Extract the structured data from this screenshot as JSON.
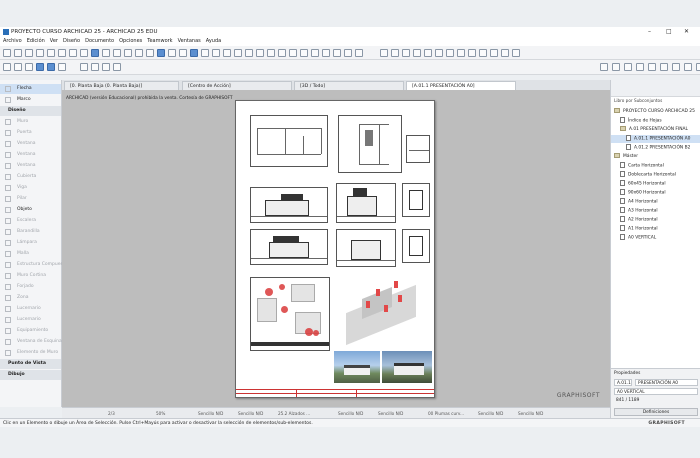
{
  "window": {
    "title": "PROYECTO CURSO ARCHICAD 25 - ARCHICAD 25 EDU",
    "minimize": "–",
    "maximize": "□",
    "close": "✕"
  },
  "menu": [
    "Archivo",
    "Edición",
    "Ver",
    "Diseño",
    "Documento",
    "Opciones",
    "Teamwork",
    "Ventanas",
    "Ayuda"
  ],
  "tabs": [
    {
      "label": "[0. Planta Baja (0. Planta Baja)]",
      "active": false
    },
    {
      "label": "[Centro de Acción]",
      "active": false
    },
    {
      "label": "[3D / Todo]",
      "active": false
    },
    {
      "label": "[A.01.1 PRESENTACIÓN A0]",
      "active": true
    }
  ],
  "toolbox": {
    "items": [
      {
        "label": "Flecha",
        "state": "sel",
        "icon": "arrow-icon"
      },
      {
        "label": "Marco",
        "state": "on",
        "icon": "marquee-icon"
      }
    ],
    "section_design": "Diseño",
    "design_items": [
      {
        "label": "Muro",
        "icon": "wall-icon",
        "state": "off"
      },
      {
        "label": "Puerta",
        "icon": "door-icon",
        "state": "off"
      },
      {
        "label": "Ventana",
        "icon": "window-icon",
        "state": "off"
      },
      {
        "label": "Ventana",
        "icon": "window-icon",
        "state": "off"
      },
      {
        "label": "Ventana",
        "icon": "window-icon",
        "state": "off"
      },
      {
        "label": "Cubierta",
        "icon": "roof-icon",
        "state": "off"
      },
      {
        "label": "Viga",
        "icon": "beam-icon",
        "state": "off"
      },
      {
        "label": "Pilar",
        "icon": "column-icon",
        "state": "off"
      },
      {
        "label": "Objeto",
        "icon": "object-icon",
        "state": "on"
      },
      {
        "label": "Escalera",
        "icon": "stair-icon",
        "state": "off"
      },
      {
        "label": "Barandilla",
        "icon": "railing-icon",
        "state": "off"
      },
      {
        "label": "Lámpara",
        "icon": "lamp-icon",
        "state": "off"
      },
      {
        "label": "Malla",
        "icon": "mesh-icon",
        "state": "off"
      },
      {
        "label": "Estructura Compuesta",
        "icon": "composite-icon",
        "state": "off"
      },
      {
        "label": "Muro Cortina",
        "icon": "curtainwall-icon",
        "state": "off"
      },
      {
        "label": "Forjado",
        "icon": "slab-icon",
        "state": "off"
      },
      {
        "label": "Zona",
        "icon": "zone-icon",
        "state": "off"
      },
      {
        "label": "Lucernario",
        "icon": "skylight-icon",
        "state": "off"
      },
      {
        "label": "Lucernario",
        "icon": "skylight-icon",
        "state": "off"
      },
      {
        "label": "Equipamiento",
        "icon": "equipment-icon",
        "state": "off"
      },
      {
        "label": "Ventana de Esquina",
        "icon": "corner-window-icon",
        "state": "off"
      },
      {
        "label": "Elemento de Muro",
        "icon": "wall-end-icon",
        "state": "off"
      }
    ],
    "section_view": "Punto de Vista",
    "section_draw": "Dibujo"
  },
  "canvas": {
    "info_text": "ARCHICAD (versión Educacional) prohibida la venta. Cortesía de GRAPHISOFT",
    "watermark": "GRAPHISOFT"
  },
  "navbar": {
    "page": "2/3",
    "zoom": "50%",
    "fields": [
      "Sencillo N/D",
      "Sencillo N/D",
      "25.2 Alzados ...",
      "Sencillo N/D",
      "Sencillo N/D",
      "00 Plumas curv...",
      "Sencillo N/D",
      "Sencillo N/D"
    ]
  },
  "navigator": {
    "header": "Libro por Subconjuntos",
    "tree": [
      {
        "label": "PROYECTO CURSO ARCHICAD 25",
        "level": 0,
        "type": "folder",
        "sel": false
      },
      {
        "label": "Índice de Hojas",
        "level": 1,
        "type": "page",
        "sel": false
      },
      {
        "label": "A.01 PRESENTACIÓN FINAL",
        "level": 1,
        "type": "folder",
        "sel": false
      },
      {
        "label": "A.01.1 PRESENTACIÓN A0",
        "level": 2,
        "type": "page",
        "sel": true
      },
      {
        "label": "A.01.2 PRESENTACIÓN B2",
        "level": 2,
        "type": "page",
        "sel": false
      },
      {
        "label": "Máster",
        "level": 0,
        "type": "folder",
        "sel": false
      },
      {
        "label": "Carta Horizontal",
        "level": 1,
        "type": "page",
        "sel": false
      },
      {
        "label": "Doblecarta Horizontal",
        "level": 1,
        "type": "page",
        "sel": false
      },
      {
        "label": "60x45 Horizontal",
        "level": 1,
        "type": "page",
        "sel": false
      },
      {
        "label": "90x60 Horizontal",
        "level": 1,
        "type": "page",
        "sel": false
      },
      {
        "label": "A4 Horizontal",
        "level": 1,
        "type": "page",
        "sel": false
      },
      {
        "label": "A3 Horizontal",
        "level": 1,
        "type": "page",
        "sel": false
      },
      {
        "label": "A2 Horizontal",
        "level": 1,
        "type": "page",
        "sel": false
      },
      {
        "label": "A1 Horizontal",
        "level": 1,
        "type": "page",
        "sel": false
      },
      {
        "label": "A0 VERTICAL",
        "level": 1,
        "type": "page",
        "sel": false
      }
    ]
  },
  "properties": {
    "title": "Propiedades",
    "id": "A.01.1",
    "name": "PRESENTACIÓN A0",
    "master": "A0 VERTICAL",
    "size": "841 / 1189",
    "button": "Definiciones"
  },
  "status": {
    "message": "Clic en un Elemento o dibuje un Área de Selección. Pulse Ctrl+Mayús para activar o desactivar la selección de elementos/sub-elementos.",
    "brand": "GRAPHISOFT"
  },
  "colors": {
    "accent": "#2a6fb8",
    "selection": "#cfe0f4",
    "marker": "#d93a3a"
  }
}
